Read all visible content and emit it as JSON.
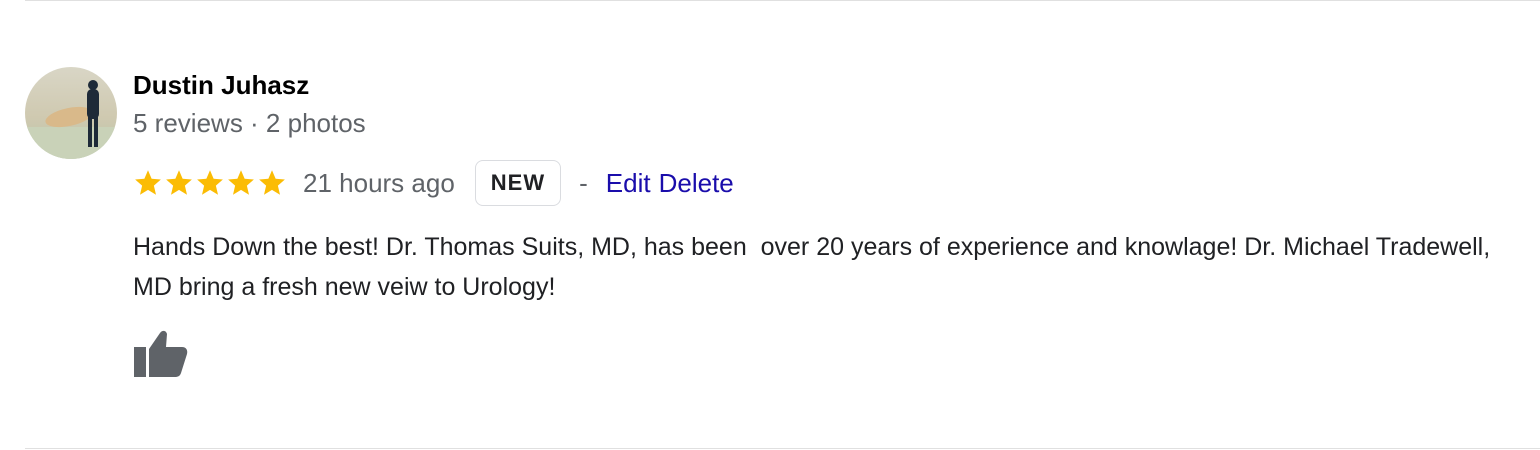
{
  "review": {
    "reviewer_name": "Dustin Juhasz",
    "reviewer_meta": "5 reviews · 2 photos",
    "rating": 5,
    "rating_max": 5,
    "time": "21 hours ago",
    "badge": "NEW",
    "separator": "-",
    "edit_label": "Edit",
    "delete_label": "Delete",
    "text": "Hands Down the best! Dr. Thomas Suits, MD, has been  over 20 years of experience and knowlage! Dr. Michael Tradewell, MD bring a fresh new veiw to Urology!"
  },
  "icons": {
    "star": "star-icon",
    "like": "thumbs-up-icon"
  },
  "colors": {
    "star": "#fbbc04",
    "link": "#1a0dab",
    "meta_text": "#5f6368",
    "icon": "#5f6368"
  }
}
